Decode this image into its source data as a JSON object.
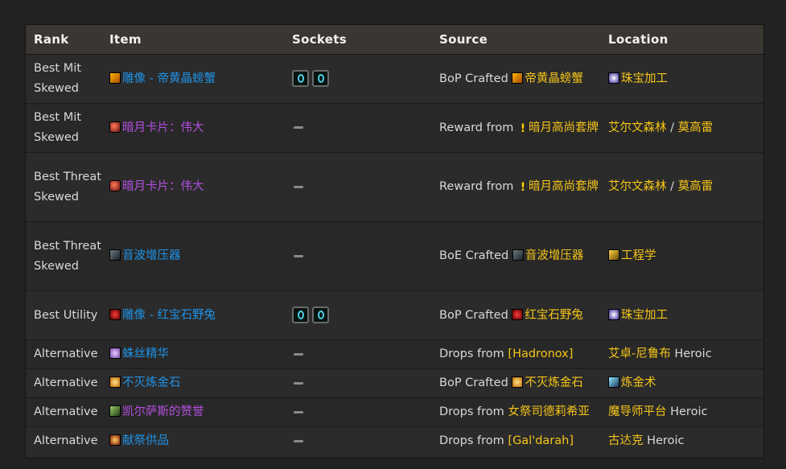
{
  "table": {
    "headers": [
      "Rank",
      "Item",
      "Sockets",
      "Source",
      "Location"
    ],
    "rows": [
      {
        "rank": "Best Mit Skewed",
        "item": "雕像 - 帝黄晶螃蟹",
        "item_color": "blue",
        "item_icon": "statue-crab-icon",
        "sockets": 2,
        "source_prefix": "BoP Crafted",
        "source_name": "帝黄晶螃蟹",
        "source_icon": "statue-crab-icon",
        "location": "珠宝加工",
        "location_icon": "jewelcrafting-icon",
        "location_suffix": ""
      },
      {
        "rank": "Best Mit Skewed",
        "item": "暗月卡片：伟大",
        "item_color": "purple",
        "item_icon": "darkmoon-card-icon",
        "sockets": 0,
        "source_prefix": "Reward from",
        "source_name": "暗月高尚套牌",
        "source_icon": "quest-icon",
        "location": "艾尔文森林",
        "location_sep": " / ",
        "location_2": "莫高雷",
        "location_suffix": ""
      },
      {
        "rank": "Best Threat Skewed",
        "item": "暗月卡片：伟大",
        "item_color": "purple",
        "item_icon": "darkmoon-card-icon",
        "sockets": 0,
        "source_prefix": "Reward from",
        "source_name": "暗月高尚套牌",
        "source_icon": "quest-icon",
        "location": "艾尔文森林",
        "location_sep": " / ",
        "location_2": "莫高雷",
        "location_suffix": ""
      },
      {
        "rank": "Best Threat Skewed",
        "item": "音波增压器",
        "item_color": "blue",
        "item_icon": "sonic-booster-icon",
        "sockets": 0,
        "source_prefix": "BoE Crafted",
        "source_name": "音波增压器",
        "source_icon": "sonic-booster-icon",
        "location": "工程学",
        "location_icon": "engineering-icon",
        "location_suffix": ""
      },
      {
        "rank": "Best Utility",
        "item": "雕像 - 红宝石野兔",
        "item_color": "blue",
        "item_icon": "statue-hare-icon",
        "sockets": 2,
        "source_prefix": "BoP Crafted",
        "source_name": "红宝石野兔",
        "source_icon": "statue-hare-icon",
        "location": "珠宝加工",
        "location_icon": "jewelcrafting-icon",
        "location_suffix": ""
      },
      {
        "rank": "Alternative",
        "item": "蛛丝精华",
        "item_color": "blue",
        "item_icon": "spider-silk-icon",
        "sockets": 0,
        "source_prefix": "Drops from",
        "source_name": "[Hadronox]",
        "location": "艾卓-尼鲁布",
        "location_suffix": " Heroic"
      },
      {
        "rank": "Alternative",
        "item": "不灭炼金石",
        "item_color": "blue",
        "item_icon": "alchemist-stone-icon",
        "sockets": 0,
        "source_prefix": "BoP Crafted",
        "source_name": "不灭炼金石",
        "source_icon": "alchemist-stone-icon",
        "location": "炼金术",
        "location_icon": "alchemy-icon",
        "location_suffix": ""
      },
      {
        "rank": "Alternative",
        "item": "凯尔萨斯的赞誉",
        "item_color": "purple",
        "item_icon": "kaelthas-icon",
        "sockets": 0,
        "source_prefix": "Drops from",
        "source_name": "女祭司德莉希亚",
        "location": "魔导师平台",
        "location_suffix": " Heroic"
      },
      {
        "rank": "Alternative",
        "item": "献祭供品",
        "item_color": "blue",
        "item_icon": "offering-icon",
        "sockets": 0,
        "source_prefix": "Drops from",
        "source_name": "[Gal'darah]",
        "location": "古达克",
        "location_suffix": " Heroic"
      }
    ]
  },
  "colors": {
    "rare_item": "#1f92e6",
    "epic_item": "#b24fdf",
    "link_gold": "#f5c518",
    "header_bg": "#3a3631",
    "row_bg": "#2b2b2b"
  }
}
